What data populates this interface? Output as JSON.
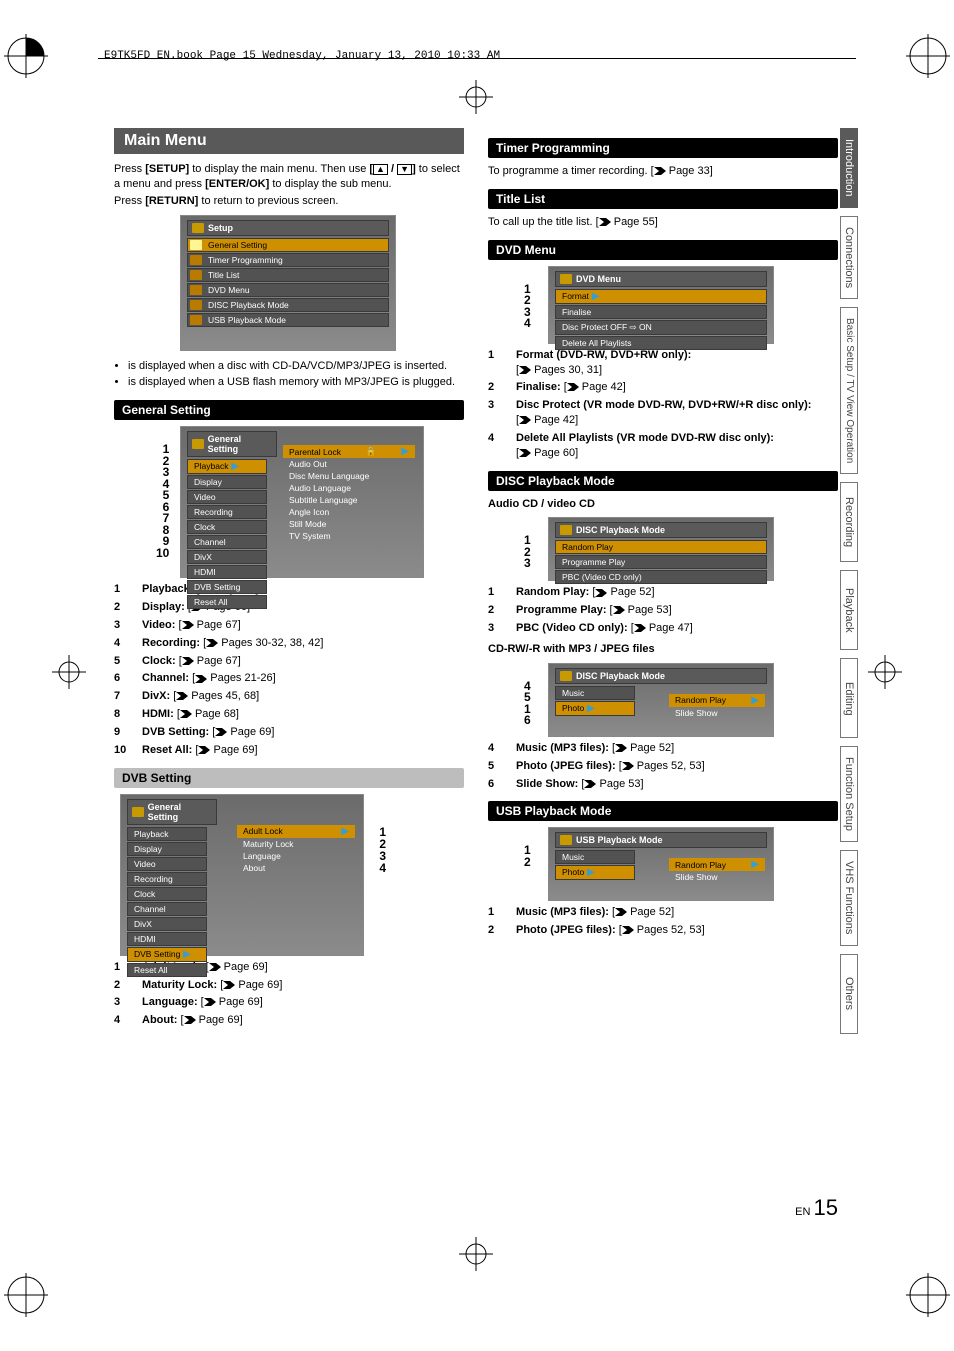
{
  "header": "E9TK5FD_EN.book  Page 15  Wednesday, January 13, 2010  10:33 AM",
  "page_footer": {
    "lang": "EN",
    "num": "15"
  },
  "tabs": [
    {
      "label": "Introduction",
      "active": true
    },
    {
      "label": "Connections"
    },
    {
      "label": "Basic Setup /\nTV View Operation",
      "two_line": true
    },
    {
      "label": "Recording"
    },
    {
      "label": "Playback"
    },
    {
      "label": "Editing"
    },
    {
      "label": "Function Setup"
    },
    {
      "label": "VHS Functions"
    },
    {
      "label": "Others"
    }
  ],
  "left": {
    "main_title": "Main Menu",
    "intro1_a": "Press ",
    "intro1_b": "[SETUP]",
    "intro1_c": " to display the main menu. Then use ",
    "intro1_d": " to select a menu and press ",
    "intro1_e": "[ENTER/OK]",
    "intro1_f": " to display the sub menu.",
    "intro2_a": "Press ",
    "intro2_b": "[RETURN]",
    "intro2_c": " to return to previous screen.",
    "setup_menu": {
      "title": "Setup",
      "items": [
        "General Setting",
        "Timer Programming",
        "Title List",
        "DVD Menu",
        "DISC Playback Mode",
        "USB Playback Mode"
      ]
    },
    "bullets": [
      "is displayed when a disc with CD-DA/VCD/MP3/JPEG is inserted.",
      "is displayed when a USB flash memory with MP3/JPEG is plugged."
    ],
    "general_heading": "General Setting",
    "general_menu": {
      "title": "General Setting",
      "left_items": [
        "Playback",
        "Display",
        "Video",
        "Recording",
        "Clock",
        "Channel",
        "DivX",
        "HDMI",
        "DVB Setting",
        "Reset All"
      ],
      "right_items": [
        "Parental Lock",
        "Audio Out",
        "Disc Menu Language",
        "Audio Language",
        "Subtitle Language",
        "Angle Icon",
        "Still Mode",
        "TV System"
      ]
    },
    "general_nums": [
      "1",
      "2",
      "3",
      "4",
      "5",
      "6",
      "7",
      "8",
      "9",
      "10"
    ],
    "general_list": [
      {
        "n": "1",
        "label": "Playback:",
        "ref": "Page 64"
      },
      {
        "n": "2",
        "label": "Display:",
        "ref": "Page 66"
      },
      {
        "n": "3",
        "label": "Video:",
        "ref": "Page 67"
      },
      {
        "n": "4",
        "label": "Recording:",
        "ref": "Pages 30-32, 38, 42"
      },
      {
        "n": "5",
        "label": "Clock:",
        "ref": "Page 67"
      },
      {
        "n": "6",
        "label": "Channel:",
        "ref": "Pages 21-26"
      },
      {
        "n": "7",
        "label": "DivX:",
        "ref": "Pages 45, 68"
      },
      {
        "n": "8",
        "label": "HDMI:",
        "ref": "Page 68"
      },
      {
        "n": "9",
        "label": "DVB Setting:",
        "ref": "Page 69"
      },
      {
        "n": "10",
        "label": "Reset All:",
        "ref": "Page 69"
      }
    ],
    "dvb_heading": "DVB Setting",
    "dvb_menu": {
      "title": "General Setting",
      "left_items": [
        "Playback",
        "Display",
        "Video",
        "Recording",
        "Clock",
        "Channel",
        "DivX",
        "HDMI",
        "DVB Setting",
        "Reset All"
      ],
      "right_items": [
        "Adult Lock",
        "Maturity Lock",
        "Language",
        "About"
      ]
    },
    "dvb_nums": [
      "1",
      "2",
      "3",
      "4"
    ],
    "dvb_list": [
      {
        "n": "1",
        "label": "Adult Lock:",
        "ref": "Page 69"
      },
      {
        "n": "2",
        "label": "Maturity Lock:",
        "ref": "Page 69"
      },
      {
        "n": "3",
        "label": "Language:",
        "ref": "Page 69"
      },
      {
        "n": "4",
        "label": "About:",
        "ref": "Page 69"
      }
    ]
  },
  "right": {
    "timer_heading": "Timer Programming",
    "timer_text_a": "To programme a timer recording. [",
    "timer_text_b": " Page 33]",
    "titlelist_heading": "Title List",
    "titlelist_text_a": "To call up the title list. [",
    "titlelist_text_b": " Page 55]",
    "dvd_heading": "DVD Menu",
    "dvd_menu": {
      "title": "DVD Menu",
      "items": [
        "Format",
        "Finalise",
        "Disc Protect OFF ⇨ ON",
        "Delete All Playlists"
      ]
    },
    "dvd_nums": [
      "1",
      "2",
      "3",
      "4"
    ],
    "dvd_list": [
      {
        "n": "1",
        "label": "Format (DVD-RW, DVD+RW only):",
        "ref": "Pages 30, 31",
        "break": true
      },
      {
        "n": "2",
        "label": "Finalise:",
        "ref": "Page 42"
      },
      {
        "n": "3",
        "label": "Disc Protect (VR mode DVD-RW, DVD+RW/+R disc only):",
        "ref": "Page 42"
      },
      {
        "n": "4",
        "label": "Delete All Playlists (VR mode DVD-RW disc only):",
        "ref": "Page 60"
      }
    ],
    "disc_heading": "DISC Playback Mode",
    "disc_sub1": "Audio CD / video CD",
    "disc_menu1": {
      "title": "DISC Playback Mode",
      "items": [
        "Random Play",
        "Programme Play",
        "PBC (Video CD only)"
      ]
    },
    "disc_nums1": [
      "1",
      "2",
      "3"
    ],
    "disc_list1": [
      {
        "n": "1",
        "label": "Random Play:",
        "ref": "Page 52"
      },
      {
        "n": "2",
        "label": "Programme Play:",
        "ref": "Page 53"
      },
      {
        "n": "3",
        "label": "PBC (Video CD only):",
        "ref": "Page 47"
      }
    ],
    "disc_sub2": "CD-RW/-R with MP3 / JPEG files",
    "disc_menu2": {
      "title": "DISC Playback Mode",
      "left_items": [
        "Music",
        "Photo"
      ],
      "right_items": [
        "Random Play",
        "Slide Show"
      ]
    },
    "disc_nums2": [
      "4",
      "5",
      "1",
      "6"
    ],
    "disc_list2": [
      {
        "n": "4",
        "label": "Music (MP3 files):",
        "ref": "Page 52"
      },
      {
        "n": "5",
        "label": "Photo (JPEG files):",
        "ref": "Pages 52, 53"
      },
      {
        "n": "6",
        "label": "Slide Show:",
        "ref": "Page 53"
      }
    ],
    "usb_heading": "USB Playback Mode",
    "usb_menu": {
      "title": "USB Playback Mode",
      "left_items": [
        "Music",
        "Photo"
      ],
      "right_items": [
        "Random Play",
        "Slide Show"
      ]
    },
    "usb_nums": [
      "1",
      "2"
    ],
    "usb_list": [
      {
        "n": "1",
        "label": "Music (MP3 files):",
        "ref": "Page 52"
      },
      {
        "n": "2",
        "label": "Photo (JPEG files):",
        "ref": "Pages 52, 53"
      }
    ]
  }
}
